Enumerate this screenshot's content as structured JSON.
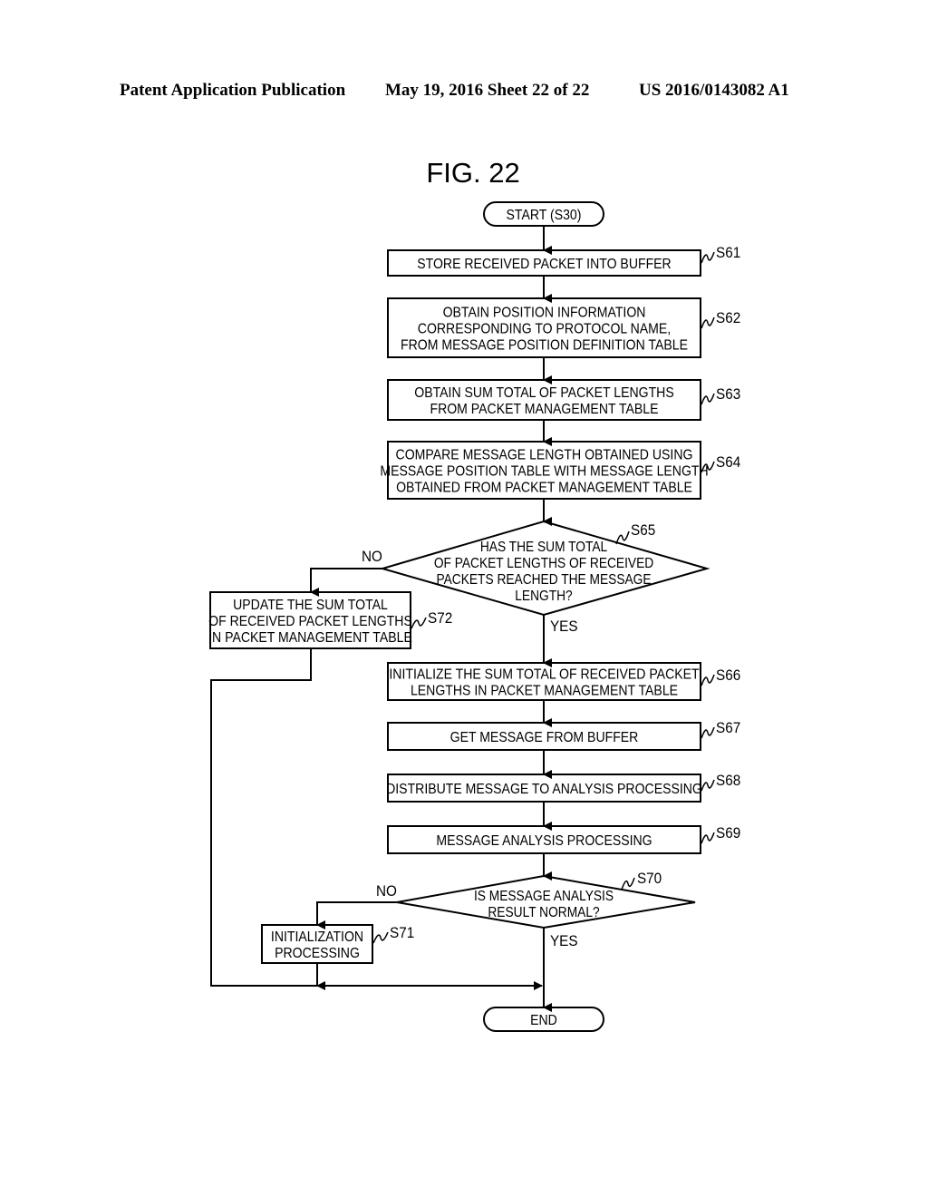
{
  "header": {
    "publication": "Patent Application Publication",
    "date_sheet": "May 19, 2016  Sheet 22 of 22",
    "patent_number": "US 2016/0143082 A1"
  },
  "figure": {
    "title": "FIG. 22",
    "start": "START (S30)",
    "end": "END",
    "steps": {
      "S61": {
        "label": "S61",
        "lines": [
          "STORE RECEIVED PACKET INTO BUFFER"
        ]
      },
      "S62": {
        "label": "S62",
        "lines": [
          "OBTAIN POSITION INFORMATION",
          "CORRESPONDING TO PROTOCOL NAME,",
          "FROM MESSAGE POSITION DEFINITION TABLE"
        ]
      },
      "S63": {
        "label": "S63",
        "lines": [
          "OBTAIN SUM TOTAL OF PACKET LENGTHS",
          "FROM PACKET MANAGEMENT TABLE"
        ]
      },
      "S64": {
        "label": "S64",
        "lines": [
          "COMPARE MESSAGE LENGTH OBTAINED USING",
          "MESSAGE POSITION TABLE WITH MESSAGE LENGTH",
          "OBTAINED FROM PACKET MANAGEMENT TABLE"
        ]
      },
      "S65": {
        "label": "S65",
        "lines": [
          "HAS THE SUM TOTAL",
          "OF PACKET LENGTHS OF RECEIVED",
          "PACKETS REACHED THE MESSAGE",
          "LENGTH?"
        ],
        "no": "NO",
        "yes": "YES"
      },
      "S66": {
        "label": "S66",
        "lines": [
          "INITIALIZE THE SUM TOTAL OF RECEIVED PACKET",
          "LENGTHS IN PACKET MANAGEMENT TABLE"
        ]
      },
      "S67": {
        "label": "S67",
        "lines": [
          "GET MESSAGE FROM BUFFER"
        ]
      },
      "S68": {
        "label": "S68",
        "lines": [
          "DISTRIBUTE MESSAGE TO ANALYSIS PROCESSING"
        ]
      },
      "S69": {
        "label": "S69",
        "lines": [
          "MESSAGE ANALYSIS PROCESSING"
        ]
      },
      "S70": {
        "label": "S70",
        "lines": [
          "IS MESSAGE ANALYSIS",
          "RESULT NORMAL?"
        ],
        "no": "NO",
        "yes": "YES"
      },
      "S71": {
        "label": "S71",
        "lines": [
          "INITIALIZATION",
          "PROCESSING"
        ]
      },
      "S72": {
        "label": "S72",
        "lines": [
          "UPDATE THE SUM TOTAL",
          "OF RECEIVED PACKET LENGTHS",
          "IN PACKET MANAGEMENT TABLE"
        ]
      }
    }
  }
}
